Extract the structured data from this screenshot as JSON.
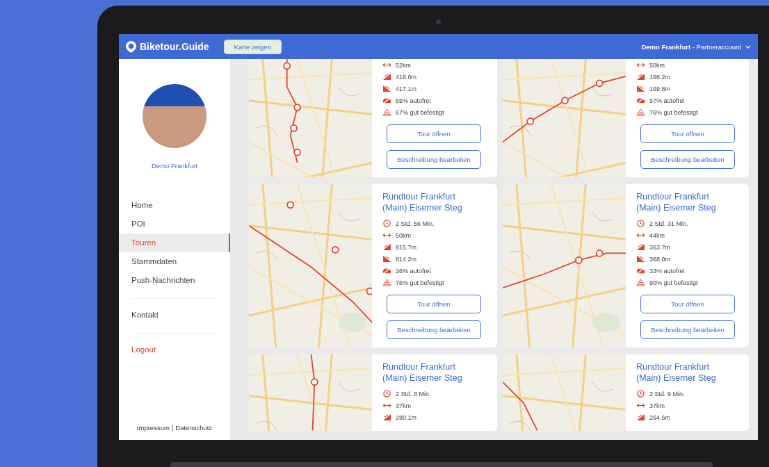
{
  "header": {
    "logo": "Biketour.Guide",
    "map_button": "Karte zeigen",
    "account_name": "Demo Frankfurt",
    "account_type": "- Partneraccount"
  },
  "sidebar": {
    "profile_name": "Demo Frankfurt",
    "menu": [
      {
        "label": "Home",
        "selected": false
      },
      {
        "label": "POI",
        "selected": false
      },
      {
        "label": "Touren",
        "selected": true
      },
      {
        "label": "Stammdaten",
        "selected": false
      },
      {
        "label": "Push-Nachrichten",
        "selected": false
      }
    ],
    "contact": "Kontakt",
    "logout": "Logout",
    "footer_links": [
      "Impressum",
      "Datenschutz"
    ],
    "footer_separator": "|"
  },
  "tours": [
    {
      "stats": [
        {
          "kind": "distance",
          "text": "52km"
        },
        {
          "kind": "ascent",
          "text": "418.0m"
        },
        {
          "kind": "descent",
          "text": "417.1m"
        },
        {
          "kind": "carfree",
          "text": "55% autofrei"
        },
        {
          "kind": "surface",
          "text": "67% gut befestigt"
        }
      ],
      "buttons": [
        "Tour öffnen",
        "Beschreibung bearbeiten"
      ]
    },
    {
      "stats": [
        {
          "kind": "distance",
          "text": "50km"
        },
        {
          "kind": "ascent",
          "text": "198.2m"
        },
        {
          "kind": "descent",
          "text": "199.8m"
        },
        {
          "kind": "carfree",
          "text": "57% autofrei"
        },
        {
          "kind": "surface",
          "text": "76% gut befestigt"
        }
      ],
      "buttons": [
        "Tour öffnen",
        "Beschreibung bearbeiten"
      ]
    },
    {
      "title": "Rundtour Frankfurt (Main) Eiserner Steg",
      "stats": [
        {
          "kind": "duration",
          "text": "2 Std. 56 Min."
        },
        {
          "kind": "distance",
          "text": "50km"
        },
        {
          "kind": "ascent",
          "text": "815.7m"
        },
        {
          "kind": "descent",
          "text": "814.2m"
        },
        {
          "kind": "carfree",
          "text": "26% autofrei"
        },
        {
          "kind": "surface",
          "text": "76% gut befestigt"
        }
      ],
      "buttons": [
        "Tour öffnen",
        "Beschreibung bearbeiten"
      ]
    },
    {
      "title": "Rundtour Frankfurt (Main) Eiserner Steg",
      "stats": [
        {
          "kind": "duration",
          "text": "2 Std. 31 Min."
        },
        {
          "kind": "distance",
          "text": "44km"
        },
        {
          "kind": "ascent",
          "text": "363.7m"
        },
        {
          "kind": "descent",
          "text": "368.0m"
        },
        {
          "kind": "carfree",
          "text": "33% autofrei"
        },
        {
          "kind": "surface",
          "text": "90% gut befestigt"
        }
      ],
      "buttons": [
        "Tour öffnen",
        "Beschreibung bearbeiten"
      ]
    },
    {
      "title": "Rundtour Frankfurt (Main) Eiserner Steg",
      "stats": [
        {
          "kind": "duration",
          "text": "2 Std. 8 Min."
        },
        {
          "kind": "distance",
          "text": "37km"
        },
        {
          "kind": "ascent",
          "text": "280.1m"
        }
      ]
    },
    {
      "title": "Rundtour Frankfurt (Main) Eiserner Steg",
      "stats": [
        {
          "kind": "duration",
          "text": "2 Std. 9 Min."
        },
        {
          "kind": "distance",
          "text": "37km"
        },
        {
          "kind": "ascent",
          "text": "264.5m"
        }
      ]
    }
  ]
}
